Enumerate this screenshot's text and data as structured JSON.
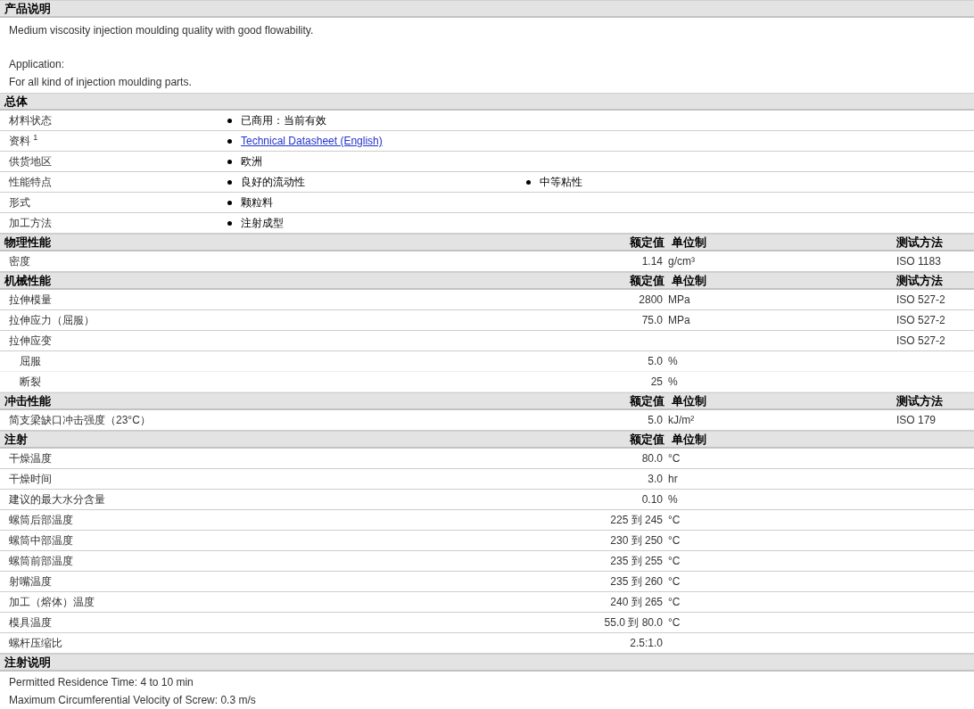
{
  "description": {
    "title": "产品说明",
    "paragraphs": [
      [
        "Medium viscosity injection moulding quality with good flowability."
      ],
      [
        "Application:",
        "For all kind of injection moulding parts."
      ]
    ]
  },
  "general": {
    "title": "总体",
    "rows": [
      {
        "label": "材料状态",
        "values": [
          {
            "kind": "text",
            "text": "已商用：当前有效"
          }
        ]
      },
      {
        "label": "资料 $^{1}$",
        "values": [
          {
            "kind": "link",
            "text": "Technical Datasheet (English)"
          }
        ]
      },
      {
        "label": "供货地区",
        "values": [
          {
            "kind": "text",
            "text": "欧洲"
          }
        ]
      },
      {
        "label": "性能特点",
        "values": [
          {
            "kind": "text",
            "text": "良好的流动性"
          },
          {
            "kind": "text",
            "text": "中等粘性"
          }
        ]
      },
      {
        "label": "形式",
        "values": [
          {
            "kind": "text",
            "text": "颗粒料"
          }
        ]
      },
      {
        "label": "加工方法",
        "values": [
          {
            "kind": "text",
            "text": "注射成型"
          }
        ]
      }
    ]
  },
  "property_sections": [
    {
      "title": "物理性能",
      "nominal_heading": "额定值",
      "unit_heading": "单位制",
      "method_heading": "测试方法",
      "rows": [
        {
          "label": "密度",
          "value": "1.14",
          "unit": "g/cm³",
          "method": "ISO 1183"
        }
      ]
    },
    {
      "title": "机械性能",
      "nominal_heading": "额定值",
      "unit_heading": "单位制",
      "method_heading": "测试方法",
      "rows": [
        {
          "label": "拉伸模量",
          "value": "2800",
          "unit": "MPa",
          "method": "ISO 527-2"
        },
        {
          "label": "拉伸应力（屈服）",
          "value": "75.0",
          "unit": "MPa",
          "method": "ISO 527-2"
        },
        {
          "label": "拉伸应变",
          "method": "ISO 527-2",
          "children": [
            {
              "label": "屈服",
              "value": "5.0",
              "unit": "%"
            },
            {
              "label": "断裂",
              "value": "25",
              "unit": "%"
            }
          ]
        }
      ]
    },
    {
      "title": "冲击性能",
      "nominal_heading": "额定值",
      "unit_heading": "单位制",
      "method_heading": "测试方法",
      "rows": [
        {
          "label": "简支梁缺口冲击强度（23°C）",
          "value": "5.0",
          "unit": "kJ/m²",
          "method": "ISO 179"
        }
      ]
    },
    {
      "title": "注射",
      "nominal_heading": "额定值",
      "unit_heading": "单位制",
      "rows": [
        {
          "label": "干燥温度",
          "value": "80.0",
          "unit": "°C"
        },
        {
          "label": "干燥时间",
          "value": "3.0",
          "unit": "hr"
        },
        {
          "label": "建议的最大水分含量",
          "value": "0.10",
          "unit": "%"
        },
        {
          "label": "螺筒后部温度",
          "value": "225 到 245",
          "unit": "°C"
        },
        {
          "label": "螺筒中部温度",
          "value": "230 到 250",
          "unit": "°C"
        },
        {
          "label": "螺筒前部温度",
          "value": "235 到 255",
          "unit": "°C"
        },
        {
          "label": "射嘴温度",
          "value": "235 到 260",
          "unit": "°C"
        },
        {
          "label": "加工（熔体）温度",
          "value": "240 到 265",
          "unit": "°C"
        },
        {
          "label": "模具温度",
          "value": "55.0 到 80.0",
          "unit": "°C"
        },
        {
          "label": "螺杆压缩比",
          "value": "2.5:1.0"
        }
      ]
    }
  ],
  "notes": {
    "title": "注射说明",
    "lines": [
      "Permitted Residence Time: 4 to 10 min",
      "Maximum Circumferential Velocity of Screw: 0.3 m/s"
    ]
  }
}
